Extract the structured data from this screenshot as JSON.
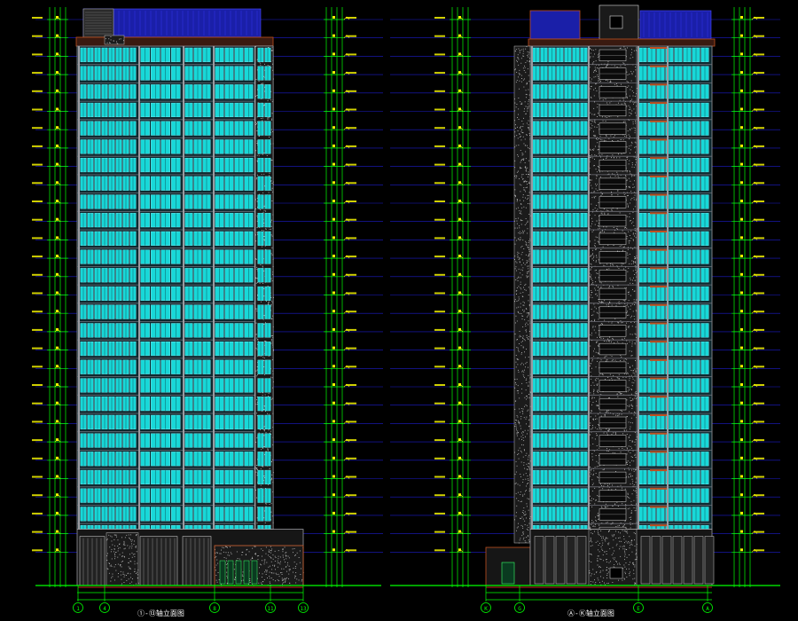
{
  "drawing": {
    "background": "#000000",
    "colors": {
      "facade_window": "#18d8d8",
      "window_frame": "#7ff8ff",
      "wall": "#9a9aa0",
      "floor_line": "#6f6f78",
      "dimension_line": "#00ff00",
      "level_text": "#f5f500",
      "guide_line": "#1c1ccc",
      "roof_panel": "#1a1fa8",
      "parapet": "#c05020",
      "accent_red": "#ff3030",
      "text_white": "#ffffff",
      "stone_texture": "#bfbfbf"
    },
    "left_elevation": {
      "title": "①-⑬轴立面图",
      "floors": 28,
      "axis_labels": [
        "1",
        "4",
        "8",
        "11",
        "13"
      ]
    },
    "right_elevation": {
      "title": "Ⓐ-Ⓚ轴立面图",
      "floors": 28,
      "axis_labels": [
        "K",
        "G",
        "E",
        "A"
      ]
    }
  }
}
